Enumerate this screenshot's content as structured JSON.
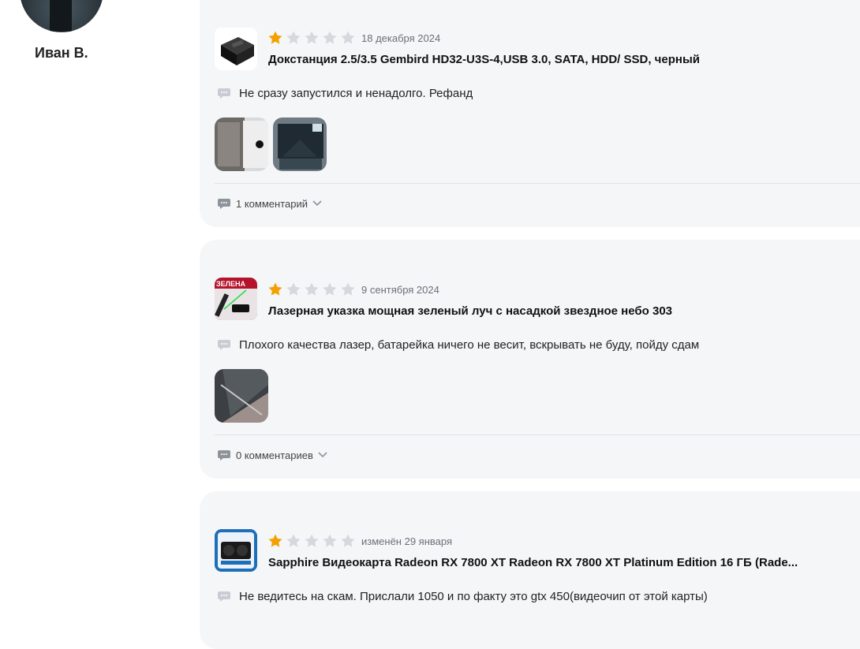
{
  "user": {
    "name": "Иван В."
  },
  "reviews": [
    {
      "date": "18 декабря 2024",
      "title": "Докстанция 2.5/3.5 Gembird HD32-U3S-4,USB 3.0, SATA, HDD/ SSD, черный",
      "text": "Не сразу запустился и ненадолго. Рефанд",
      "rating": 1,
      "rating_max": 5,
      "photos": 2,
      "comments_label": "1 комментарий"
    },
    {
      "date": "9 сентября 2024",
      "title": "Лазерная указка мощная зеленый луч с насадкой звездное небо 303",
      "text": "Плохого качества лазер, батарейка ничего не весит, вскрывать не буду, пойду сдам",
      "rating": 1,
      "rating_max": 5,
      "photos": 1,
      "comments_label": "0 комментариев",
      "thumb_caption": "ЗЕЛЕНА"
    },
    {
      "date": "изменён 29 января",
      "title": "Sapphire Видеокарта Radeon RX 7800 XT Radeon RX 7800 XT Platinum Edition 16 ГБ (Rade...",
      "text": "Не ведитесь на скам. Прислали 1050 и по факту это gtx 450(видеочип от этой карты)",
      "rating": 1,
      "rating_max": 5
    }
  ],
  "colors": {
    "star_active": "#f5a000",
    "star_inactive": "#d5d8dd",
    "card_bg": "#f5f6f8"
  },
  "icons": {
    "message": "message-icon",
    "chevron": "chevron-down-icon",
    "star": "star-icon"
  }
}
